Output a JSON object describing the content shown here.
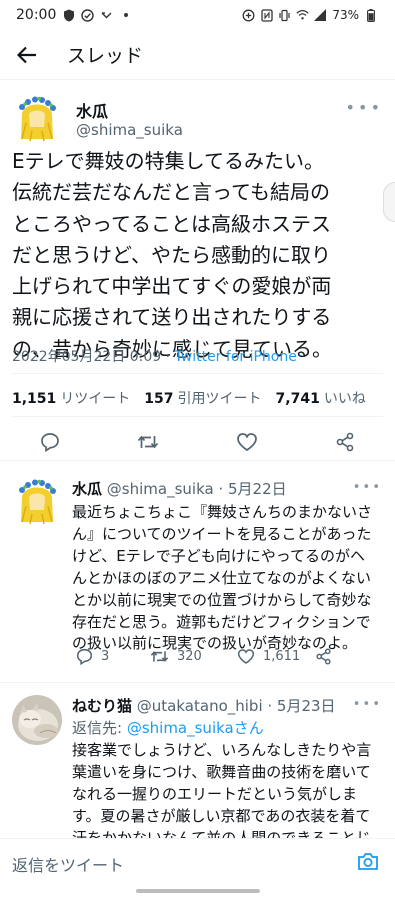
{
  "status_bar": {
    "time": "20:00",
    "battery": "73%"
  },
  "header": {
    "title": "スレッド"
  },
  "main_tweet": {
    "name": "水瓜",
    "handle": "@shima_suika",
    "body_lines": [
      "Eテレで舞妓の特集してるみたい。",
      "伝統だ芸だなんだと言っても結局の",
      "ところやってることは高級ホステス",
      "だと思うけど、やたら感動的に取り",
      "上げられて中学出てすぐの愛娘が両",
      "親に応援されて送り出されたりする",
      "の、昔から奇妙に感じて見ている。"
    ],
    "date": "2022年05月22日 0:09",
    "separator": " · ",
    "via": "Twitter for iPhone",
    "stats": {
      "retweets_count": "1,151",
      "retweets_label": "リツイート",
      "quotes_count": "157",
      "quotes_label": "引用ツイート",
      "likes_count": "7,741",
      "likes_label": "いいね"
    }
  },
  "replies": [
    {
      "name": "水瓜",
      "handle": "@shima_suika",
      "date": " · 5月22日",
      "body_lines": [
        "最近ちょこちょこ『舞妓さんちのまかないさ",
        "ん』についてのツイートを見ることがあった",
        "けど、Eテレで子ども向けにやってるのがヘ",
        "んとかほのぼのアニメ仕立てなのがよくない",
        "とか以前に現実での位置づけからして奇妙な",
        "存在だと思う。遊郭もだけどフィクションで",
        "の扱い以前に現実での扱いが奇妙なのよ。"
      ],
      "replies_count": "3",
      "retweets_count": "320",
      "likes_count": "1,611"
    },
    {
      "name": "ねむり猫",
      "handle": "@utakatano_hibi",
      "date": " · 5月23日",
      "replying_label": "返信先: ",
      "replying_to": "@shima_suikaさん",
      "body_lines": [
        "接客業でしょうけど、いろんなしきたりや言",
        "葉遣いを身につけ、歌舞音曲の技術を磨いて",
        "なれる一握りのエリートだという気がしま",
        "す。夏の暑さが厳しい京都であの衣装を着て",
        "汗をかかないなんて並の人間のできることじ"
      ]
    }
  ],
  "compose": {
    "placeholder": "返信をツイート"
  },
  "colors": {
    "accent": "#1d9bf0",
    "text": "#0f1419",
    "secondary": "#536471"
  }
}
